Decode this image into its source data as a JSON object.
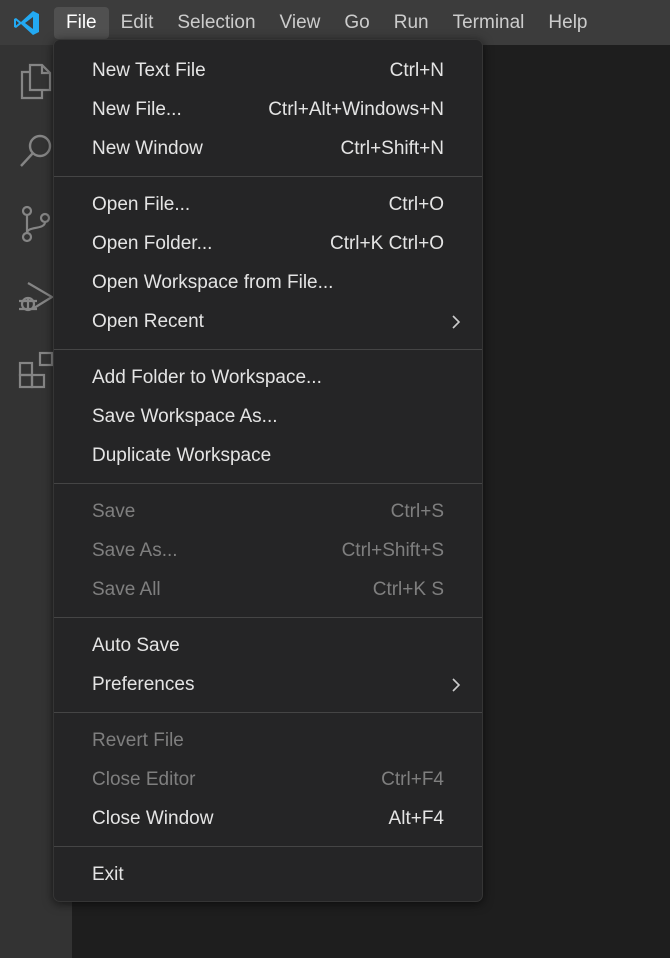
{
  "menubar": {
    "items": [
      {
        "label": "File"
      },
      {
        "label": "Edit"
      },
      {
        "label": "Selection"
      },
      {
        "label": "View"
      },
      {
        "label": "Go"
      },
      {
        "label": "Run"
      },
      {
        "label": "Terminal"
      },
      {
        "label": "Help"
      }
    ]
  },
  "activitybar": {
    "icons": [
      "explorer-icon",
      "search-icon",
      "source-control-icon",
      "run-debug-icon",
      "extensions-icon"
    ]
  },
  "file_menu": {
    "groups": [
      [
        {
          "label": "New Text File",
          "shortcut": "Ctrl+N"
        },
        {
          "label": "New File...",
          "shortcut": "Ctrl+Alt+Windows+N"
        },
        {
          "label": "New Window",
          "shortcut": "Ctrl+Shift+N"
        }
      ],
      [
        {
          "label": "Open File...",
          "shortcut": "Ctrl+O"
        },
        {
          "label": "Open Folder...",
          "shortcut": "Ctrl+K Ctrl+O"
        },
        {
          "label": "Open Workspace from File...",
          "shortcut": ""
        },
        {
          "label": "Open Recent",
          "shortcut": "",
          "submenu": true
        }
      ],
      [
        {
          "label": "Add Folder to Workspace...",
          "shortcut": ""
        },
        {
          "label": "Save Workspace As...",
          "shortcut": ""
        },
        {
          "label": "Duplicate Workspace",
          "shortcut": ""
        }
      ],
      [
        {
          "label": "Save",
          "shortcut": "Ctrl+S",
          "disabled": true
        },
        {
          "label": "Save As...",
          "shortcut": "Ctrl+Shift+S",
          "disabled": true
        },
        {
          "label": "Save All",
          "shortcut": "Ctrl+K S",
          "disabled": true
        }
      ],
      [
        {
          "label": "Auto Save",
          "shortcut": ""
        },
        {
          "label": "Preferences",
          "shortcut": "",
          "submenu": true
        }
      ],
      [
        {
          "label": "Revert File",
          "shortcut": "",
          "disabled": true
        },
        {
          "label": "Close Editor",
          "shortcut": "Ctrl+F4",
          "disabled": true
        },
        {
          "label": "Close Window",
          "shortcut": "Alt+F4"
        }
      ],
      [
        {
          "label": "Exit",
          "shortcut": ""
        }
      ]
    ]
  },
  "colors": {
    "titlebar": "#3c3c3c",
    "activitybar": "#333333",
    "menu_bg": "#252526",
    "accent_logo": "#23a9f2",
    "text": "#e4e4e4",
    "disabled_text": "#7f7f7f"
  }
}
